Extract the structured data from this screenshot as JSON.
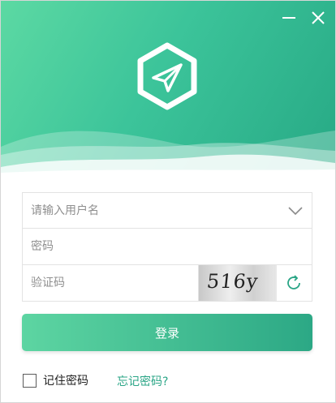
{
  "window": {
    "minimize_icon": "minimize-icon",
    "close_icon": "close-icon"
  },
  "header": {
    "logo_icon": "paper-plane-hexagon-icon",
    "gradient_colors": [
      "#5cd9a3",
      "#27a985"
    ]
  },
  "form": {
    "username": {
      "placeholder": "请输入用户名",
      "value": "",
      "dropdown_icon": "chevron-down-icon"
    },
    "password": {
      "placeholder": "密码",
      "value": ""
    },
    "captcha": {
      "placeholder": "验证码",
      "value": "",
      "image_text": "516y",
      "refresh_icon": "refresh-icon"
    }
  },
  "login_button": {
    "label": "登录"
  },
  "remember": {
    "label": "记住密码",
    "checked": false
  },
  "forgot_link": {
    "label": "忘记密码?"
  },
  "colors": {
    "accent": "#2aa586"
  }
}
